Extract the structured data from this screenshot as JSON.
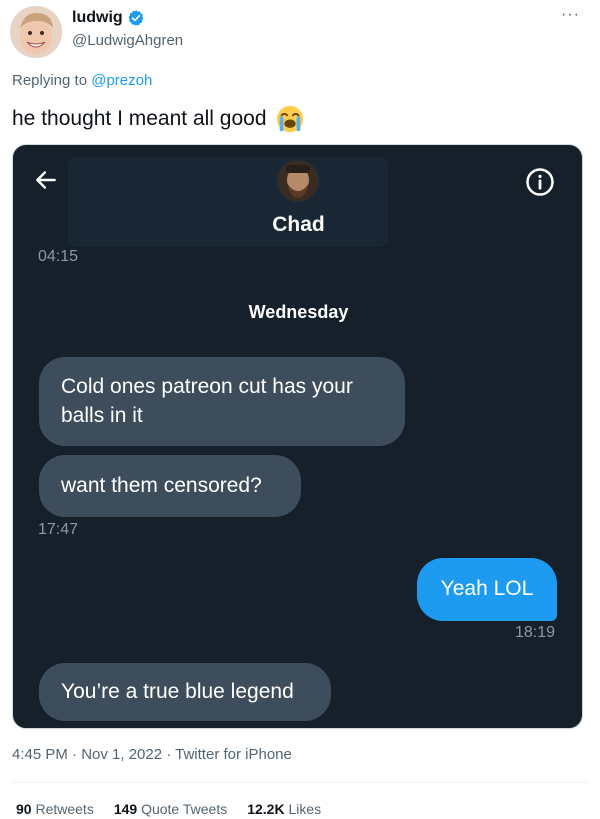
{
  "author": {
    "display_name": "ludwig",
    "handle": "@LudwigAhgren",
    "verified": true
  },
  "reply": {
    "prefix": "Replying to ",
    "mention": "@prezoh"
  },
  "tweet_text": "he thought I meant all good",
  "tweet_emoji": "loudly-crying-face",
  "screenshot": {
    "contact_name": "Chad",
    "top_time": "04:15",
    "day_label": "Wednesday",
    "messages": [
      {
        "direction": "in",
        "text": "Cold ones patreon cut has your balls in it"
      },
      {
        "direction": "in",
        "text": "want them censored?"
      },
      {
        "direction": "out",
        "text": "Yeah LOL"
      },
      {
        "direction": "in",
        "text": "You’re a true blue legend"
      }
    ],
    "timestamps": [
      "17:47",
      "18:19"
    ]
  },
  "meta": {
    "time_date": "4:45 PM · Nov 1, 2022 · ",
    "source": "Twitter for iPhone"
  },
  "stats": {
    "retweets_count": "90",
    "retweets_label": " Retweets",
    "quotes_count": "149",
    "quotes_label": " Quote Tweets",
    "likes_count": "12.2K",
    "likes_label": " Likes"
  },
  "colors": {
    "accent": "#1d9bf0",
    "dm_background": "#15202b",
    "incoming_bubble": "#3d4d5c"
  }
}
